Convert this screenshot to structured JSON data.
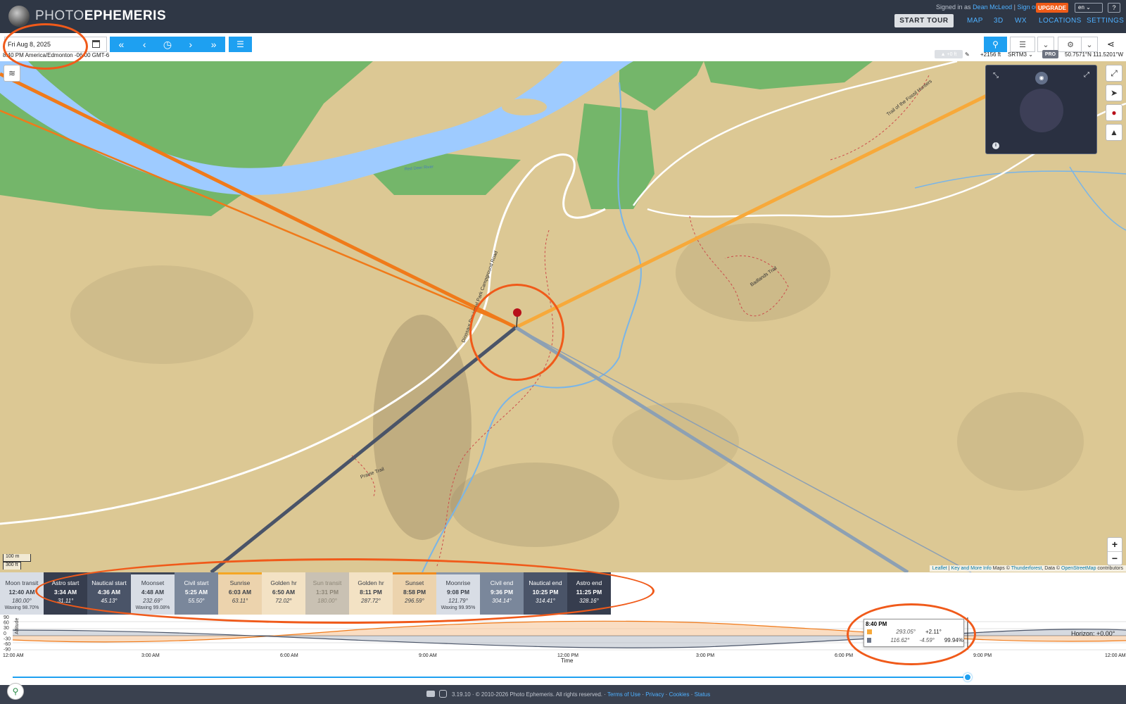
{
  "header": {
    "logo_light": "PHOTO",
    "logo_bold": "EPHEMERIS",
    "signed_in_prefix": "Signed in as",
    "user_name": "Dean McLeod",
    "sign_out": "Sign out",
    "upgrade": "UPGRADE",
    "language": "en",
    "help": "?",
    "start_tour": "START TOUR",
    "nav": [
      "MAP",
      "3D",
      "WX",
      "LOCATIONS",
      "SETTINGS"
    ]
  },
  "toolbar": {
    "date": "Fri Aug 8, 2025",
    "timezone": "8:40 PM America/Edmonton -06:00 GMT-6",
    "elevation_offset": "+0 ft",
    "elevation": "+2156 ft",
    "dem": "SRTM3",
    "pro": "PRO",
    "coordinates": "50.7571°N 111.5201°W"
  },
  "map": {
    "labels": [
      "Dinosaur Provincial Park Campground Road",
      "Trail of the Fossil Hunters",
      "Badlands Trail",
      "Prairie Trail",
      "Red Deer River"
    ],
    "scale_metric": "100 m",
    "scale_imperial": "300 ft",
    "attribution": {
      "leaflet": "Leaflet",
      "sep1": " | ",
      "keyinfo": "Key and More Info",
      "maps": " Maps © ",
      "thunderforest": "Thunderforest",
      "data": ", Data © ",
      "osm": "OpenStreetMap",
      "contrib": " contributors"
    },
    "zoom_in": "+",
    "zoom_out": "−"
  },
  "events": [
    {
      "name": "Moon transit",
      "time": "12:40 AM",
      "deg": "180.00°",
      "extra": "Waxing 98.70%",
      "bg": "#d8dde5",
      "fg": "#3a3f48",
      "bar": ""
    },
    {
      "name": "Astro start",
      "time": "3:34 AM",
      "deg": "31.11°",
      "extra": "",
      "bg": "#363d4e",
      "fg": "#ffffff",
      "bar": ""
    },
    {
      "name": "Nautical start",
      "time": "4:36 AM",
      "deg": "45.13°",
      "extra": "",
      "bg": "#4a5468",
      "fg": "#ffffff",
      "bar": ""
    },
    {
      "name": "Moonset",
      "time": "4:48 AM",
      "deg": "232.69°",
      "extra": "Waxing 99.08%",
      "bg": "#d8dde5",
      "fg": "#3a3f48",
      "bar": "#3e4656"
    },
    {
      "name": "Civil start",
      "time": "5:25 AM",
      "deg": "55.50°",
      "extra": "",
      "bg": "#7a879b",
      "fg": "#ffffff",
      "bar": ""
    },
    {
      "name": "Sunrise",
      "time": "6:03 AM",
      "deg": "63.11°",
      "extra": "",
      "bg": "#ecd3ad",
      "fg": "#3a3f48",
      "bar": "#f5a623"
    },
    {
      "name": "Golden hr",
      "time": "6:50 AM",
      "deg": "72.02°",
      "extra": "",
      "bg": "#f3e2c4",
      "fg": "#3a3f48",
      "bar": ""
    },
    {
      "name": "Sun transit",
      "time": "1:31 PM",
      "deg": "180.00°",
      "extra": "",
      "bg": "#c9c1b3",
      "fg": "#8d8677",
      "bar": ""
    },
    {
      "name": "Golden hr",
      "time": "8:11 PM",
      "deg": "287.72°",
      "extra": "",
      "bg": "#f3e2c4",
      "fg": "#3a3f48",
      "bar": ""
    },
    {
      "name": "Sunset",
      "time": "8:58 PM",
      "deg": "296.59°",
      "extra": "",
      "bg": "#ecd3ad",
      "fg": "#3a3f48",
      "bar": "#f08b1f"
    },
    {
      "name": "Moonrise",
      "time": "9:08 PM",
      "deg": "121.79°",
      "extra": "Waxing 99.95%",
      "bg": "#d8dde5",
      "fg": "#3a3f48",
      "bar": "#8895a8"
    },
    {
      "name": "Civil end",
      "time": "9:36 PM",
      "deg": "304.14°",
      "extra": "",
      "bg": "#7a879b",
      "fg": "#ffffff",
      "bar": ""
    },
    {
      "name": "Nautical end",
      "time": "10:25 PM",
      "deg": "314.41°",
      "extra": "",
      "bg": "#4a5468",
      "fg": "#ffffff",
      "bar": ""
    },
    {
      "name": "Astro end",
      "time": "11:25 PM",
      "deg": "328.16°",
      "extra": "",
      "bg": "#363d4e",
      "fg": "#ffffff",
      "bar": ""
    }
  ],
  "timeline": {
    "y_label": "Altitude",
    "y_ticks": [
      "90",
      "60",
      "30",
      "0",
      "-30",
      "-60",
      "-90"
    ],
    "x_ticks": [
      "12:00 AM",
      "3:00 AM",
      "6:00 AM",
      "9:00 AM",
      "12:00 PM",
      "3:00 PM",
      "6:00 PM",
      "9:00 PM",
      "12:00 AM"
    ],
    "x_label": "Time",
    "horizon": "Horizon: +0.00°",
    "current_fraction": 0.861,
    "tooltip": {
      "time": "8:40 PM",
      "sun_az": "293.05°",
      "sun_alt": "+2.11°",
      "moon_az": "116.62°",
      "moon_alt": "-4.59°",
      "moon_illum": "99.94%"
    }
  },
  "footer": {
    "version": "3.19.10 · © 2010-2026 Photo Ephemeris. All rights reserved. ·",
    "links": [
      "Terms of Use",
      "Privacy",
      "Cookies",
      "Status"
    ]
  },
  "colors": {
    "accent": "#1ea0f1",
    "sun_line": "#f07a1a",
    "sunrise_line": "#f7a93a",
    "moon_line": "#4a5468",
    "moonrise_line": "#8da0b3",
    "annotation": "#f05a1a"
  }
}
